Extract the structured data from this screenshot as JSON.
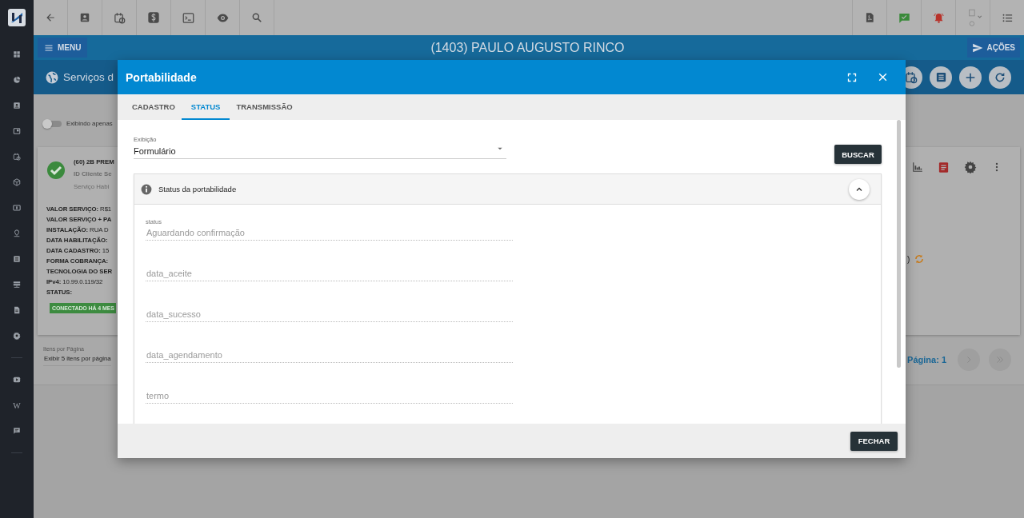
{
  "sidebar": {
    "wiki_label": "W"
  },
  "header": {
    "menu_button": "MENU",
    "client_title": "(1403) PAULO AUGUSTO RINCO",
    "actions_button": "AÇÕES"
  },
  "page": {
    "title": "Serviços d",
    "filter_toggle": {
      "label": "Exibindo apenas",
      "on": false
    },
    "service_card": {
      "name": "(60) 2B PREM",
      "client_id": "ID Cliente Se",
      "service_state": "Serviço Habi",
      "details": [
        {
          "label": "VALOR SERVIÇO:",
          "value": "R$1"
        },
        {
          "label": "VALOR SERVIÇO + PA"
        },
        {
          "label": "INSTALAÇÃO:",
          "value": "RUA D"
        },
        {
          "label": "DATA HABILITAÇÃO:"
        },
        {
          "label": "DATA CADASTRO:",
          "value": "15"
        },
        {
          "label": "FORMA COBRANÇA:"
        },
        {
          "label": "TECNOLOGIA DO SER"
        },
        {
          "label": "IPv4:",
          "value": "10.99.0.119/32"
        },
        {
          "label": "STATUS:"
        }
      ],
      "status_badge": "CONECTADO HÁ 4 MES",
      "column_fragment": ")"
    },
    "items_per_page": {
      "label": "Itens por Página",
      "value": "Exibir 5 itens por página"
    },
    "page_indicator": "Página: 1"
  },
  "modal": {
    "title": "Portabilidade",
    "tabs": [
      {
        "label": "CADASTRO",
        "selected": false
      },
      {
        "label": "STATUS",
        "selected": true
      },
      {
        "label": "TRANSMISSÃO",
        "selected": false
      }
    ],
    "display_select": {
      "label": "Exibição",
      "value": "Formulário"
    },
    "search_button": "BUSCAR",
    "panel": {
      "title": "Status da portabilidade",
      "expanded": true,
      "fields": [
        {
          "label": "status",
          "value": "Aguardando confirmação"
        },
        {
          "placeholder": "data_aceite"
        },
        {
          "placeholder": "data_sucesso"
        },
        {
          "placeholder": "data_agendamento"
        },
        {
          "placeholder": "termo"
        }
      ]
    },
    "close_button": "FECHAR"
  }
}
